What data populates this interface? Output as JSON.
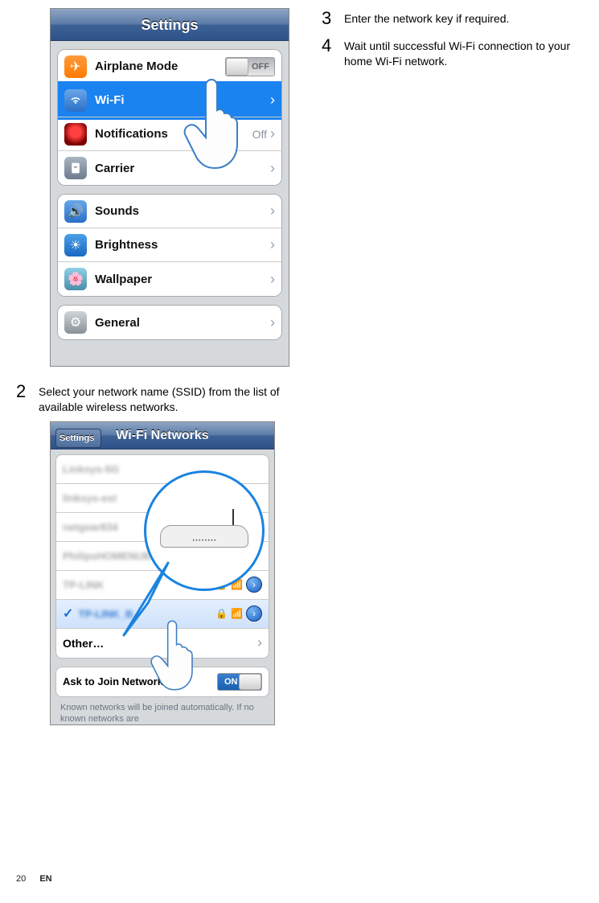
{
  "screenshot1": {
    "title": "Settings",
    "groups": [
      {
        "rows": [
          {
            "icon": "airplane",
            "label": "Airplane Mode",
            "toggle": {
              "state": "off",
              "text": "OFF"
            }
          },
          {
            "icon": "wifi",
            "label": "Wi-Fi",
            "chevron": true,
            "highlighted": true
          },
          {
            "icon": "notif",
            "label": "Notifications",
            "chevron": true,
            "value": "Off"
          },
          {
            "icon": "carrier",
            "label": "Carrier",
            "chevron": true
          }
        ]
      },
      {
        "rows": [
          {
            "icon": "sounds",
            "label": "Sounds",
            "chevron": true
          },
          {
            "icon": "bright",
            "label": "Brightness",
            "chevron": true
          },
          {
            "icon": "wall",
            "label": "Wallpaper",
            "chevron": true
          }
        ]
      },
      {
        "rows": [
          {
            "icon": "general",
            "label": "General",
            "chevron": true
          }
        ]
      }
    ]
  },
  "steps": {
    "s2": {
      "num": "2",
      "text": "Select your network name (SSID) from the list of available wireless networks."
    },
    "s3": {
      "num": "3",
      "text": "Enter the network key if required."
    },
    "s4": {
      "num": "4",
      "text": "Wait until successful Wi-Fi connection to your home Wi-Fi network."
    }
  },
  "screenshot2": {
    "back": "Settings",
    "title": "Wi-Fi Networks",
    "other_label": "Other…",
    "ask_label": "Ask to Join Networks",
    "ask_toggle": {
      "state": "on",
      "text": "ON"
    },
    "footnote": "Known networks will be joined automatically. If no known networks are"
  },
  "footer": {
    "page": "20",
    "lang": "EN"
  }
}
